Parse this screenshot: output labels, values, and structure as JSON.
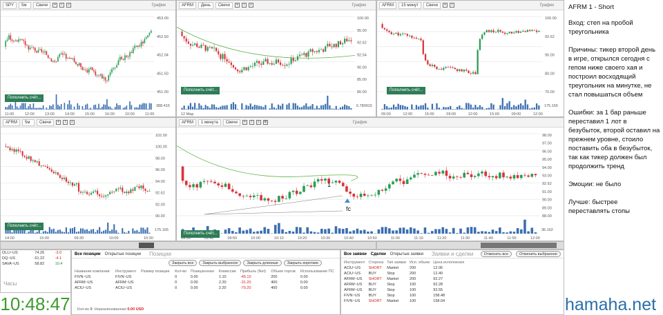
{
  "charts": {
    "spy": {
      "ticker": "SPY",
      "tf": "5м",
      "type": "Свечи",
      "title": "График",
      "btn": "Пополнить счёт...",
      "prices": [
        "453.00",
        "452.50",
        "452.04",
        "451.50",
        "451.00"
      ],
      "vol": "388.415",
      "times": [
        "11:00",
        "12:00",
        "13:00",
        "14:00",
        "15:00",
        "16:00",
        "10:00",
        "11:00"
      ]
    },
    "afrm_day": {
      "ticker": "AFRM",
      "tf": "День",
      "type": "Свечи",
      "title": "График",
      "btn": "Пополнить счёт...",
      "prices": [
        "100.00",
        "95.00",
        "92.62",
        "92.54",
        "90.00",
        "85.00",
        "80.00"
      ],
      "vol": "6.780915",
      "dates": [
        "12 Мар"
      ]
    },
    "afrm_15": {
      "ticker": "AFRM",
      "tf": "15 минут",
      "type": "Свечи",
      "title": "График",
      "btn": "Пополнить счёт...",
      "prices": [
        "100.00",
        "92.62",
        "90.00",
        "80.00",
        "70.00"
      ],
      "vol": "175.165",
      "times": [
        "09:00",
        "12:00",
        "15:00",
        "09:00",
        "12:00",
        "15:00",
        "09:00",
        "12:00"
      ]
    },
    "afrm_5": {
      "ticker": "AFRM",
      "tf": "5м",
      "type": "Свечи",
      "title": "График",
      "btn": "Пополнить счёт...",
      "prices": [
        "102.00",
        "100.00",
        "98.00",
        "96.00",
        "94.00",
        "92.62",
        "92.00",
        "90.00"
      ],
      "vol": "175.165",
      "vol2": "1,000,000",
      "times": [
        "14:00",
        "15:00",
        "09:30",
        "10:00",
        "10:30"
      ]
    },
    "afrm_1": {
      "ticker": "AFRM",
      "tf": "1 минута",
      "type": "Свечи",
      "title": "График",
      "btn": "Пополнить счёт...",
      "prices": [
        "98.00",
        "97.00",
        "96.00",
        "95.00",
        "94.00",
        "93.00",
        "92.62",
        "91.00",
        "90.00",
        "89.00",
        "88.00"
      ],
      "lines": [
        "93.86",
        "92.62"
      ],
      "vol": "36.162",
      "times": [
        "09:30",
        "09:40",
        "09:50",
        "10:00",
        "10:10",
        "10:20",
        "10:30",
        "10:40",
        "10:50",
        "11:00",
        "11:10",
        "11:20",
        "11:30",
        "11:40",
        "11:50",
        "12:00"
      ],
      "mark1": "1",
      "markfc": "fc"
    }
  },
  "watch": {
    "rows": [
      {
        "sym": "OLLI~US",
        "price": "74.26",
        "chg": "-3.0"
      },
      {
        "sym": "DQ~US",
        "price": "61.22",
        "chg": "-4.1"
      },
      {
        "sym": "SAVA~US",
        "price": "58.82",
        "chg": "10.4"
      }
    ],
    "label": "Часы"
  },
  "clock": "10:48:47",
  "positions": {
    "tabs": [
      "Все позиции",
      "Открытые позиции"
    ],
    "big": "Позиции",
    "buttons": [
      "Закрыть все",
      "Закрыть выбранное",
      "Закрыть длинные",
      "Закрыть короткие"
    ],
    "cols": [
      "Название компании",
      "Инструмент",
      "Размер позиции",
      "Кол-во",
      "Позиционная",
      "Комиссии",
      "Прибыль (Net)",
      "Объем торгов",
      "Использование ПС"
    ],
    "rows": [
      {
        "name": "FIVN~US",
        "inst": "FIVN~US",
        "size": "",
        "qty": "0",
        "pos": "0.00",
        "com": "1.10",
        "pnl": "-45.10",
        "vol": "200",
        "use": "0.00"
      },
      {
        "name": "AFRM~US",
        "inst": "AFRM~US",
        "size": "",
        "qty": "0",
        "pos": "0.00",
        "com": "2.20",
        "pnl": "-31.20",
        "vol": "400",
        "use": "0.00"
      },
      {
        "name": "ACIU~US",
        "inst": "ACIU~US",
        "size": "",
        "qty": "0",
        "pos": "0.00",
        "com": "2.20",
        "pnl": "-70.20",
        "vol": "400",
        "use": "0.00"
      }
    ],
    "footer_label": "Кол-во",
    "footer_qty": "0",
    "footer_unreal": "Нереализованная",
    "footer_val": "0.00 USD"
  },
  "orders": {
    "tabs": [
      "Все заявки",
      "Сделки",
      "Открытые заявки"
    ],
    "big": "Заявки и сделки",
    "pills": [
      "Отменить все",
      "Отменить выбранное"
    ],
    "cols": [
      "Инструмент",
      "Сторона",
      "Тип заявки",
      "Исп. объем",
      "Цена исполнения"
    ],
    "rows": [
      {
        "sym": "ACIU~US",
        "side": "SHORT",
        "type": "Market",
        "qty": "200",
        "price": "12.06"
      },
      {
        "sym": "ACIU~US",
        "side": "BUY",
        "type": "Stop",
        "qty": "200",
        "price": "12.40"
      },
      {
        "sym": "AFRM~US",
        "side": "SHORT",
        "type": "Market",
        "qty": "200",
        "price": "92.27"
      },
      {
        "sym": "AFRM~US",
        "side": "BUY",
        "type": "Stop",
        "qty": "100",
        "price": "92.28"
      },
      {
        "sym": "AFRM~US",
        "side": "BUY",
        "type": "Stop",
        "qty": "100",
        "price": "92.55"
      },
      {
        "sym": "FIVN~US",
        "side": "BUY",
        "type": "Stop",
        "qty": "100",
        "price": "158.48"
      },
      {
        "sym": "FIVN~US",
        "side": "SHORT",
        "type": "Market",
        "qty": "100",
        "price": "158.04"
      }
    ]
  },
  "notes": {
    "title": "AFRM  1 - Short",
    "entry": "Вход: степ на пробой треугольника",
    "reasons": "Причины: тикер второй день в игре, открылся сегодня с гепом ниже своего хая и построил восходящий треугольник на минутке, не стал повышаться объем",
    "errors": "Ошибки: за 1 бар раньше переставил 1 лот в безубыток, второй оставил на прежнем уровне, стоило поставить оба в безубыток, так как тикер должен был продолжить тренд",
    "emotions": "Эмоции: не было",
    "better": "Лучше: быстрее переставлять стопы"
  },
  "brand": "hamaha.net",
  "colors": {
    "up": "#2a9d55",
    "down": "#d8343a",
    "ma": "#5fb34a",
    "ma2": "#4a4ad0",
    "btn": "#2e7d57",
    "clock": "#3c9b2e",
    "brand": "#2c6ea8"
  }
}
